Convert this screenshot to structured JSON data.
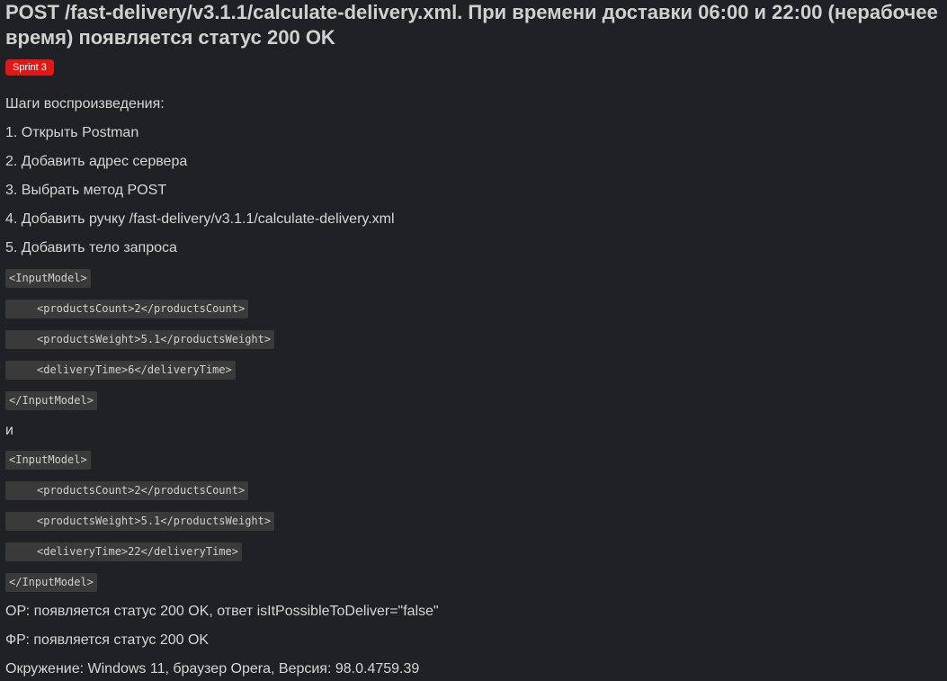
{
  "issue": {
    "title": "POST /fast-delivery/v3.1.1/calculate-delivery.xml. При времени доставки 06:00 и 22:00 (нерабочее время) появляется статус 200 OK",
    "badge": "Sprint 3",
    "badge_color": "#e01818"
  },
  "body": {
    "steps_heading": "Шаги воспроизведения:",
    "steps": [
      "1. Открыть Postman",
      "2. Добавить адрес сервера",
      "3. Выбрать метод POST",
      "4. Добавить ручку /fast-delivery/v3.1.1/calculate-delivery.xml",
      "5. Добавить тело запроса"
    ],
    "request1": {
      "open": "<InputModel>",
      "products_count": "<productsCount>2</productsCount>",
      "products_weight": "<productsWeight>5.1</productsWeight>",
      "delivery_time": "<deliveryTime>6</deliveryTime>",
      "close": "</InputModel>"
    },
    "conjunction": "и",
    "request2": {
      "open": "<InputModel>",
      "products_count": "<productsCount>2</productsCount>",
      "products_weight": "<productsWeight>5.1</productsWeight>",
      "delivery_time": "<deliveryTime>22</deliveryTime>",
      "close": "</InputModel>"
    },
    "expected": "ОР: появляется статус 200 OK, ответ isItPossibleToDeliver=\"false\"",
    "actual": "ФР: появляется статус 200 OK",
    "environment": "Окружение: Windows 11, браузер Opera, Версия: 98.0.4759.39"
  }
}
